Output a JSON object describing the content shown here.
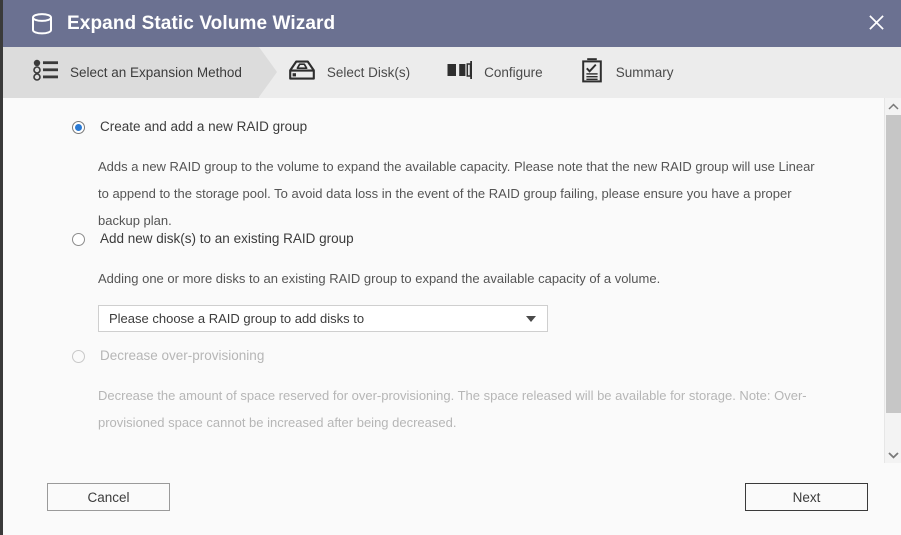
{
  "window": {
    "title": "Expand Static Volume Wizard",
    "title_icon": "volume-cylinder-icon",
    "close_icon": "close-icon",
    "header_color": "#6b7191"
  },
  "steps": [
    {
      "label": "Select an Expansion Method",
      "icon": "list-bullets-icon",
      "active": true
    },
    {
      "label": "Select Disk(s)",
      "icon": "hard-disk-icon",
      "active": false
    },
    {
      "label": "Configure",
      "icon": "partition-bars-icon",
      "active": false
    },
    {
      "label": "Summary",
      "icon": "clipboard-check-icon",
      "active": false
    }
  ],
  "options": [
    {
      "id": "create-new-raid-group",
      "title": "Create and add a new RAID group",
      "description": "Adds a new RAID group to the volume to expand the available capacity. Please note that the new RAID group will use Linear to append to the storage pool. To avoid data loss in the event of the RAID group failing, please ensure you have a proper backup plan.",
      "selected": true,
      "disabled": false
    },
    {
      "id": "add-disks-existing-raid-group",
      "title": "Add new disk(s) to an existing RAID group",
      "description": "Adding one or more disks to an existing RAID group to expand the available capacity of a volume.",
      "selected": false,
      "disabled": false
    },
    {
      "id": "decrease-over-provisioning",
      "title": "Decrease over-provisioning",
      "description": "Decrease the amount of space reserved for over-provisioning. The space released will be available for storage. Note: Over-provisioned space cannot be increased after being decreased.",
      "selected": false,
      "disabled": true
    }
  ],
  "raid_group_select": {
    "value": "Please choose a RAID group to add disks to",
    "caret_icon": "chevron-down-icon"
  },
  "scrollbar": {
    "up_icon": "chevron-up-icon",
    "down_icon": "chevron-down-icon"
  },
  "footer": {
    "cancel_label": "Cancel",
    "next_label": "Next"
  },
  "colors": {
    "accent_radio": "#2a7ad4",
    "titlebar": "#6b7191",
    "step_active_bg": "#dcdcdc",
    "step_bg": "#ececec"
  }
}
